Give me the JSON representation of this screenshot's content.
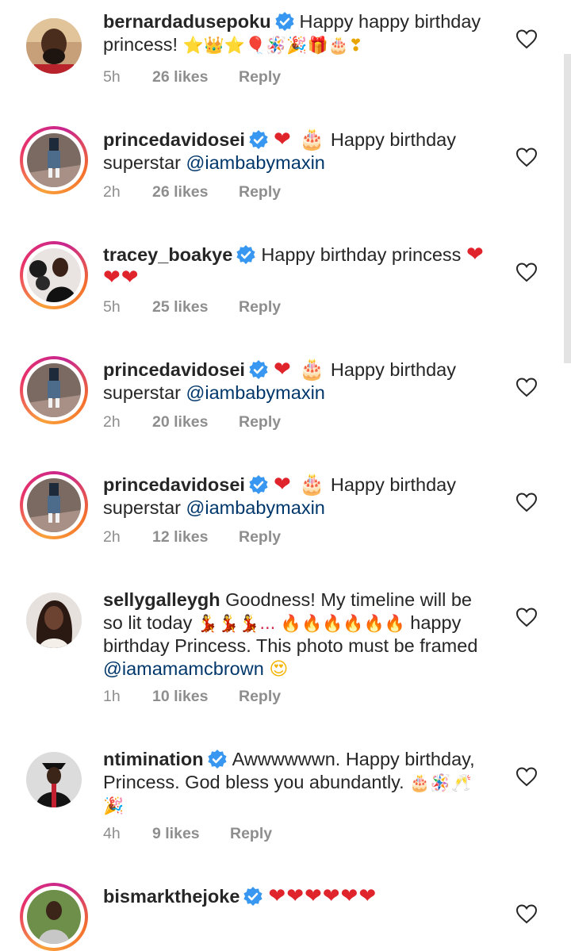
{
  "comments": [
    {
      "username": "bernardadusepoku",
      "verified": true,
      "text_lines": [
        "Happy happy birthday",
        "princess! "
      ],
      "emoji_tail": "⭐👑⭐🎈🪅🎉🎁🎂❣",
      "time": "5h",
      "likes": "26 likes",
      "reply": "Reply",
      "avatar": "man-beard-avatar"
    },
    {
      "username": "princedavidosei",
      "verified": true,
      "lead_emoji": "❤ 🎂",
      "text_lines": [
        "Happy birthday",
        "superstar "
      ],
      "mention": "@iambabymaxin",
      "time": "2h",
      "likes": "26 likes",
      "reply": "Reply",
      "avatar": "walk-of-fame-avatar"
    },
    {
      "username": "tracey_boakye",
      "verified": true,
      "text_lines": [
        "Happy birthday princess"
      ],
      "hearts_line1": "❤",
      "hearts_line2": "❤❤",
      "time": "5h",
      "likes": "25 likes",
      "reply": "Reply",
      "avatar": "woman-balloons-avatar"
    },
    {
      "username": "princedavidosei",
      "verified": true,
      "lead_emoji": "❤ 🎂",
      "text_lines": [
        "Happy birthday",
        "superstar "
      ],
      "mention": "@iambabymaxin",
      "time": "2h",
      "likes": "20 likes",
      "reply": "Reply",
      "avatar": "walk-of-fame-avatar"
    },
    {
      "username": "princedavidosei",
      "verified": true,
      "lead_emoji": "❤ 🎂",
      "text_lines": [
        "Happy birthday",
        "superstar "
      ],
      "mention": "@iambabymaxin",
      "time": "2h",
      "likes": "12 likes",
      "reply": "Reply",
      "avatar": "walk-of-fame-avatar"
    },
    {
      "username": "sellygalleygh",
      "verified": false,
      "line1": "Goodness! My timeline will be",
      "line2_text": "so lit today ",
      "line2_emoji": "💃💃💃...",
      "line2_fire": "🔥🔥🔥🔥🔥🔥",
      "line2_end": " happy",
      "line3": "birthday Princess. This photo must be framed",
      "mention": "@iamamamcbrown",
      "mention_emoji": "😍",
      "time": "1h",
      "likes": "10 likes",
      "reply": "Reply",
      "avatar": "woman-portrait-avatar"
    },
    {
      "username": "ntimination",
      "verified": true,
      "line1": "Awwwwwwn. Happy birthday,",
      "line2": "Princess. God bless you abundantly. ",
      "line2_emoji": "🎂🪅🥂",
      "line3_emoji": "🎉",
      "time": "4h",
      "likes": "9 likes",
      "reply": "Reply",
      "avatar": "man-graduation-avatar"
    },
    {
      "username": "bismarkthejoke",
      "verified": true,
      "hearts": "❤❤❤❤❤❤",
      "avatar": "man-outdoor-avatar"
    }
  ],
  "icons": {
    "verified": "verified-badge-icon",
    "like": "heart-outline-icon"
  },
  "colors": {
    "verified_blue": "#3897f0",
    "mention": "#00376b",
    "meta_gray": "#8e8e8e",
    "heart_red": "#e0242c"
  }
}
